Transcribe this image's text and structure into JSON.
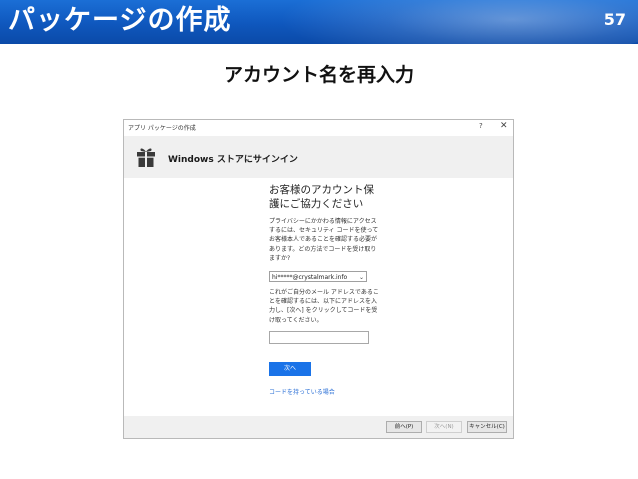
{
  "slide": {
    "title": "パッケージの作成",
    "page_number": "57",
    "subtitle": "アカウント名を再入力"
  },
  "window": {
    "title": "アプリ パッケージの作成",
    "help_label": "?",
    "close_label": "✕",
    "banner_title": "Windows ストアにサインイン",
    "heading": "お客様のアカウント保護にご協力ください",
    "description": "プライバシーにかかわる情報にアクセスするには、セキュリティ コードを使ってお客様本人であることを確認する必要があります。どの方法でコードを受け取りますか?",
    "account_select": {
      "value": "hi*****@crystalmark.info"
    },
    "instruction": "これがご自分のメール アドレスであることを確認するには、以下にアドレスを入力し、[次へ] をクリックしてコードを受け取ってください。",
    "code_input": {
      "value": "",
      "placeholder": ""
    },
    "next_button": "次へ",
    "have_code_link": "コードを持っている場合",
    "footer": {
      "prev_button": "前へ(P)",
      "next_button": "次へ(N)",
      "cancel_button": "キャンセル(C)"
    }
  },
  "colors": {
    "header_blue": "#0f57bd",
    "accent_blue": "#1a73e8",
    "link_blue": "#2a6fd6"
  },
  "icons": {
    "banner_icon": "gift-icon",
    "dropdown_icon": "chevron-down-icon"
  }
}
